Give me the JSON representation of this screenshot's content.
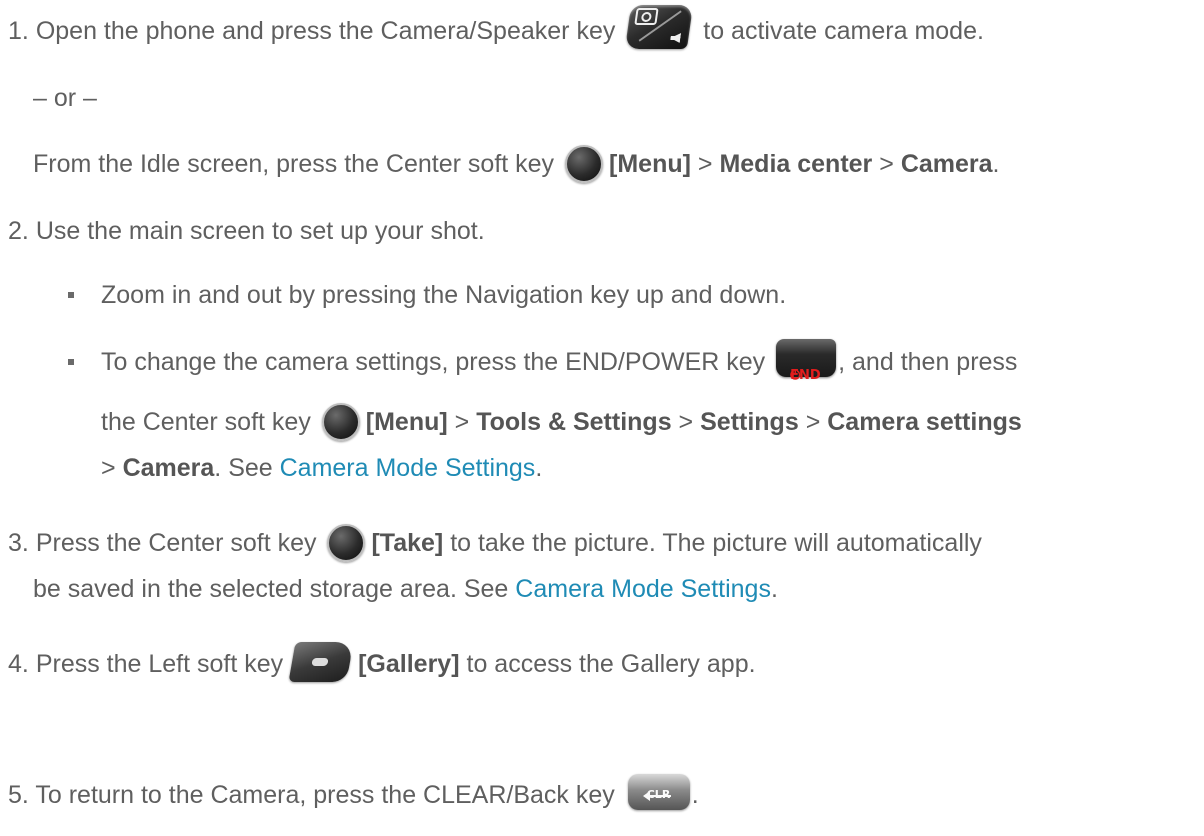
{
  "steps": {
    "s1": {
      "num": "1.",
      "before_key": "Open the phone and press the Camera/Speaker key",
      "after_key": "to activate camera mode.",
      "or": "– or –",
      "alt_before": "From the Idle screen, press the Center soft key",
      "alt_menu": "[Menu]",
      "sep1": ">",
      "alt_media": "Media center",
      "sep2": ">",
      "alt_camera": "Camera",
      "end_period": "."
    },
    "s2": {
      "num": "2.",
      "text": "Use the main screen to set up your shot.",
      "bullet1": "Zoom in and out by pressing the Navigation key up and down.",
      "bullet2_before": "To change the camera settings, press the END/POWER key",
      "bullet2_after": ", and then press",
      "line2_before": "the Center soft key",
      "menu": "[Menu]",
      "sep1": ">",
      "tools": "Tools & Settings",
      "sep2": ">",
      "settings": "Settings",
      "sep3": ">",
      "camera_settings": "Camera settings",
      "line3_sep": ">",
      "line3_camera": "Camera",
      "line3_see": ". See",
      "link": "Camera Mode Settings",
      "line3_end": "."
    },
    "s3": {
      "num": "3.",
      "before": "Press the Center soft key",
      "take": "[Take]",
      "after": "to take the picture. The picture will automatically",
      "line2": "be saved in the selected storage area. See",
      "link": "Camera Mode Settings",
      "end": "."
    },
    "s4": {
      "num": "4.",
      "before": "Press the Left soft key",
      "gallery": "[Gallery]",
      "after": "to access the Gallery app."
    },
    "s5": {
      "num": "5.",
      "before": "To return to the Camera, press the CLEAR/Back key",
      "end": "."
    }
  },
  "keys": {
    "end_label": "END",
    "end_symbol": "⏻",
    "clr_label": "CLR"
  },
  "colors": {
    "text": "#5f5f5f",
    "link": "#1f8bb5",
    "end_red": "#e21d1d"
  }
}
